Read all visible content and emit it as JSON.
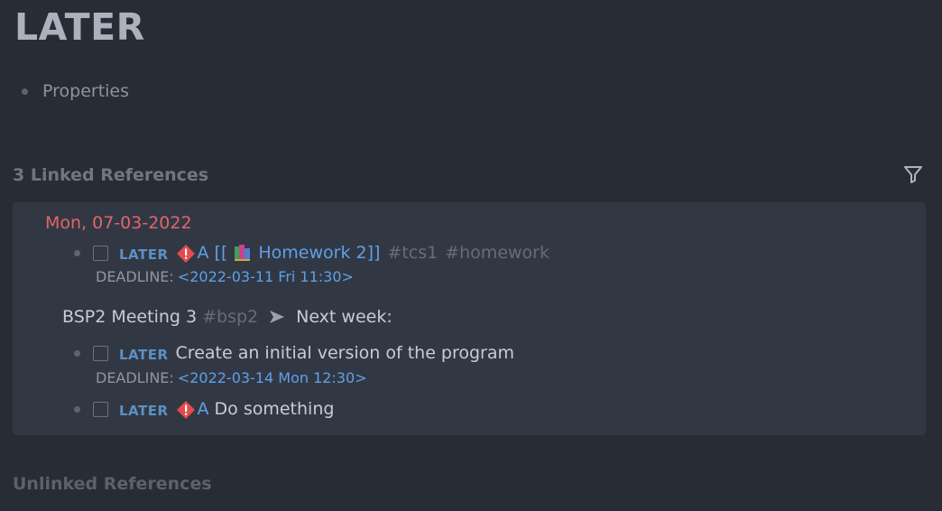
{
  "page": {
    "title": "LATER"
  },
  "properties": {
    "label": "Properties"
  },
  "linked": {
    "title": "3 Linked References",
    "group_date": "Mon, 07-03-2022",
    "block1": {
      "marker": "LATER",
      "priority": "A",
      "open_bracket": "[[",
      "page_link": "Homework 2",
      "close_bracket": "]]",
      "tag1": "#tcs1",
      "tag2": "#homework",
      "deadline_label": "DEADLINE:",
      "deadline_value": "<2022-03-11 Fri 11:30>"
    },
    "breadcrumb": {
      "parent": "BSP2 Meeting 3",
      "tag": "#bsp2",
      "child": "Next week:"
    },
    "block2": {
      "marker": "LATER",
      "text": "Create an initial version of the program",
      "deadline_label": "DEADLINE:",
      "deadline_value": "<2022-03-14 Mon 12:30>"
    },
    "block3": {
      "marker": "LATER",
      "priority": "A",
      "text": "Do something"
    }
  },
  "unlinked": {
    "title": "Unlinked References"
  },
  "icons": {
    "filter": "filter-icon",
    "priority": "priority-warning-icon",
    "page": "books-icon",
    "breadcrumb_arrow": "arrow-right-icon"
  },
  "colors": {
    "background": "#282c34",
    "panel": "#323843",
    "date": "#e1656b",
    "link": "#5ea0e8",
    "marker": "#5b91c6",
    "priority_icon": "#e54b4b"
  }
}
